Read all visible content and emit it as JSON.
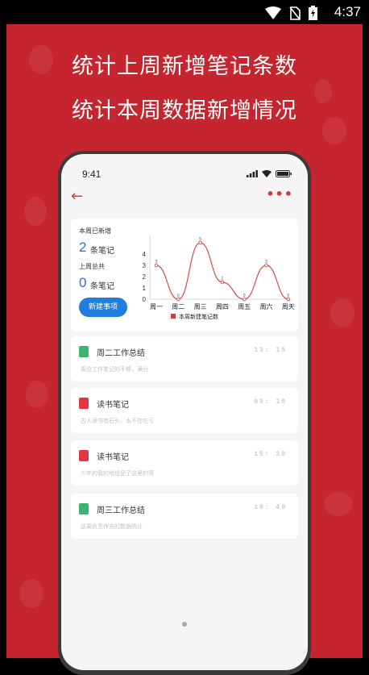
{
  "status_bar": {
    "time": "4:37"
  },
  "headlines": [
    "统计上周新增笔记条数",
    "统计本周数据新增情况"
  ],
  "phone": {
    "time": "9:41",
    "stats": {
      "this_week_label": "本周已新增",
      "this_week_count": "2",
      "this_week_unit": "条笔记",
      "last_week_label": "上周总共",
      "last_week_count": "0",
      "last_week_unit": "条笔记",
      "new_button": "新建事项"
    },
    "notes": [
      {
        "title": "周二工作总结",
        "time": "13: 15",
        "preview": "周总工作笔记的不够，满分",
        "icon": "green-download-icon",
        "icon_color": "#3cb371"
      },
      {
        "title": "读书笔记",
        "time": "09: 10",
        "preview": "古人读书有石头，水不在吃亏",
        "icon": "red-document-icon",
        "icon_color": "#e0353c"
      },
      {
        "title": "读书笔记",
        "time": "15: 30",
        "preview": "少年的我的地给足了这里的哥",
        "icon": "red-document-icon",
        "icon_color": "#e0353c"
      },
      {
        "title": "周三工作总结",
        "time": "19: 40",
        "preview": "这周负责作充的数据统计",
        "icon": "green-download-icon",
        "icon_color": "#3cb371"
      }
    ]
  },
  "chart_data": {
    "type": "line",
    "categories": [
      "周一",
      "周二",
      "周三",
      "周四",
      "周五",
      "周六",
      "周天"
    ],
    "series": [
      {
        "name": "本周新建笔记数",
        "values": [
          3,
          0,
          5,
          1.5,
          0,
          3,
          0
        ]
      }
    ],
    "point_labels": [
      "3",
      "0",
      "5",
      "1",
      "0",
      "3",
      "0"
    ],
    "y_ticks": [
      "0",
      "1",
      "2",
      "3",
      "4"
    ],
    "ylim": [
      0,
      5
    ],
    "legend": "bottom",
    "colors": {
      "line": "#d44a4a",
      "legend": "#e0353c"
    }
  },
  "colors": {
    "background": "#c5252e",
    "accent_red": "#e0353c",
    "accent_blue": "#1e7fe0"
  }
}
